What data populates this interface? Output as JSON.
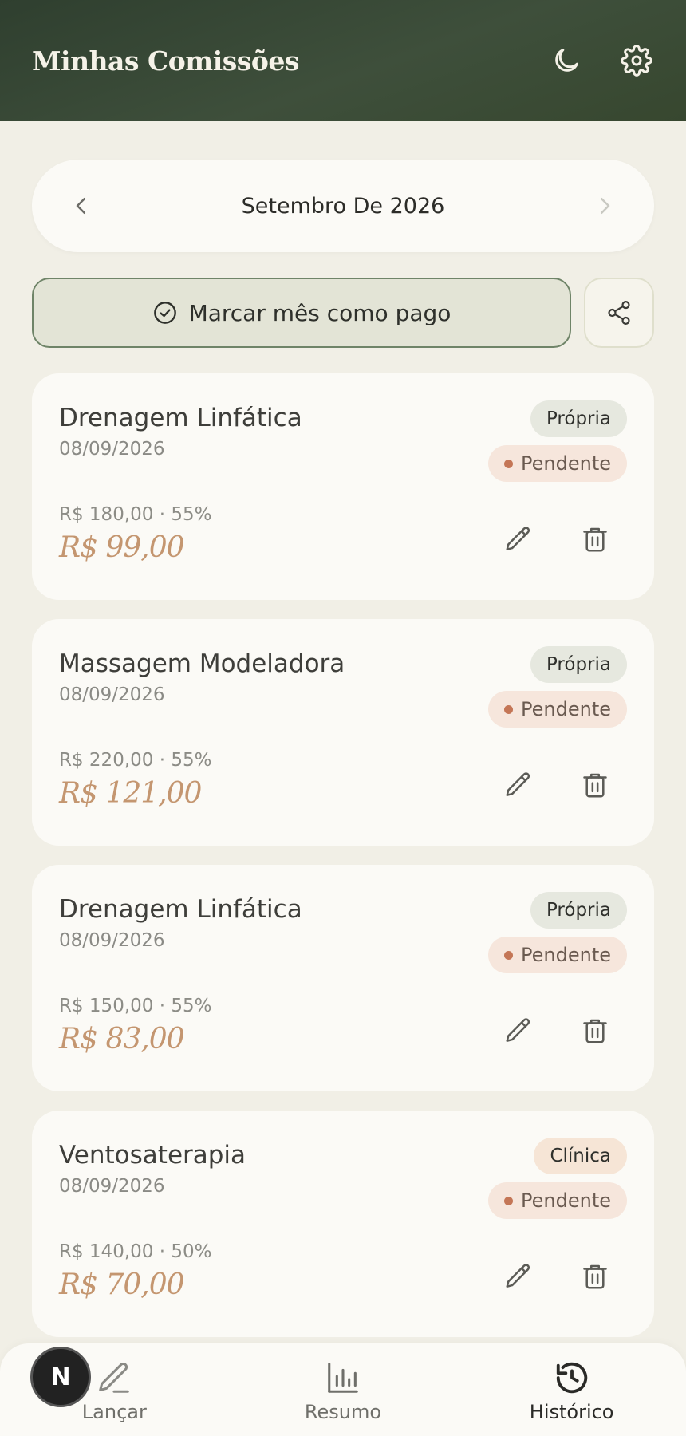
{
  "header": {
    "title": "Minhas Comissões",
    "icons": [
      "moon-icon",
      "gear-icon"
    ]
  },
  "month_nav": {
    "label": "Setembro De 2026"
  },
  "actions": {
    "mark_paid_label": "Marcar mês como pago",
    "share_icon": "share-icon"
  },
  "entries": [
    {
      "title": "Drenagem Linfática",
      "date": "08/09/2026",
      "type": "Própria",
      "status": "Pendente",
      "base": "R$ 180,00 · 55%",
      "amount": "R$ 99,00"
    },
    {
      "title": "Massagem Modeladora",
      "date": "08/09/2026",
      "type": "Própria",
      "status": "Pendente",
      "base": "R$ 220,00 · 55%",
      "amount": "R$ 121,00"
    },
    {
      "title": "Drenagem Linfática",
      "date": "08/09/2026",
      "type": "Própria",
      "status": "Pendente",
      "base": "R$ 150,00 · 55%",
      "amount": "R$ 83,00"
    },
    {
      "title": "Ventosaterapia",
      "date": "08/09/2026",
      "type": "Clínica",
      "status": "Pendente",
      "base": "R$ 140,00 · 50%",
      "amount": "R$ 70,00"
    }
  ],
  "bottom_nav": {
    "items": [
      {
        "label": "Lançar",
        "icon": "pencil-icon"
      },
      {
        "label": "Resumo",
        "icon": "bar-chart-icon"
      },
      {
        "label": "Histórico",
        "icon": "history-icon"
      }
    ],
    "active": "Histórico"
  },
  "avatar": {
    "initial": "N"
  },
  "colors": {
    "header_bg": "#3a4a37",
    "page_bg": "#f1efe6",
    "card_bg": "#fbfaf6",
    "amount": "#c49670",
    "status_dot": "#c47656"
  }
}
